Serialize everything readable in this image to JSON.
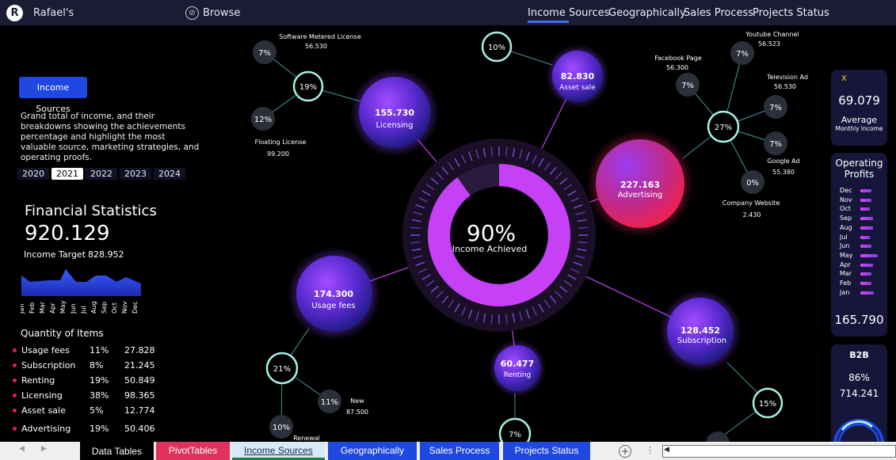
{
  "app": {
    "brand": "Rafael's",
    "logo_letter": "R",
    "browse_label": "Browse"
  },
  "nav": {
    "items": [
      {
        "label": "Income Sources",
        "active": true
      },
      {
        "label": "Geographically"
      },
      {
        "label": "Sales Process"
      },
      {
        "label": "Projects Status"
      }
    ]
  },
  "left": {
    "button_label": "Income Sources",
    "description": "Grand total of income, and their breakdowns showing the achievements percentage and highlight the most valuable source, marketing strategies, and operating proofs.",
    "years": [
      "2020",
      "2021",
      "2022",
      "2023",
      "2024"
    ],
    "active_year": "2021",
    "fin_title": "Financial Statistics",
    "fin_value": "920.129",
    "target_label": "Income Target",
    "target_value": "828.952",
    "sparkline_months": [
      "Jan",
      "Feb",
      "Mar",
      "Apr",
      "May",
      "Jun",
      "Jul",
      "Aug",
      "Sep",
      "Oct",
      "Nov",
      "Dec"
    ],
    "qty_title": "Quantity of Items",
    "items": [
      {
        "name": "Usage fees",
        "pct": "11%",
        "value": "27.828"
      },
      {
        "name": "Subscription",
        "pct": "8%",
        "value": "21.245"
      },
      {
        "name": "Renting",
        "pct": "19%",
        "value": "50.849"
      },
      {
        "name": "Licensing",
        "pct": "38%",
        "value": "98.365"
      },
      {
        "name": "Asset sale",
        "pct": "5%",
        "value": "12.774"
      },
      {
        "name": "Advertising",
        "pct": "19%",
        "value": "50.406"
      }
    ]
  },
  "center": {
    "percent": "90%",
    "label": "Income Achieved",
    "fraction": 0.9
  },
  "bubbles": [
    {
      "key": "licensing",
      "value": "155.730",
      "label": "Licensing"
    },
    {
      "key": "asset-sale",
      "value": "82.830",
      "label": "Asset sale"
    },
    {
      "key": "advertising",
      "value": "227.163",
      "label": "Advertising"
    },
    {
      "key": "usage-fees",
      "value": "174.300",
      "label": "Usage fees"
    },
    {
      "key": "renting",
      "value": "60.477",
      "label": "Renting"
    },
    {
      "key": "subscription",
      "value": "128.452",
      "label": "Subscription"
    }
  ],
  "hubs": [
    "19%",
    "10%",
    "27%",
    "21%",
    "7%",
    "15%"
  ],
  "leaves": [
    {
      "key": "software-metered",
      "pct": "7%",
      "name": "Software Metered License",
      "value": "56.530"
    },
    {
      "key": "floating-license",
      "pct": "12%",
      "name": "Floating License",
      "value": "99.200"
    },
    {
      "key": "facebook-page",
      "pct": "7%",
      "name": "Facebook Page",
      "value": "56.300"
    },
    {
      "key": "youtube-channel",
      "pct": "7%",
      "name": "Youtube Channel",
      "value": "56.523"
    },
    {
      "key": "television-ad",
      "pct": "7%",
      "name": "Television Ad",
      "value": "56.530"
    },
    {
      "key": "google-ad",
      "pct": "7%",
      "name": "Google Ad",
      "value": "55.380"
    },
    {
      "key": "company-website",
      "pct": "0%",
      "name": "Company Website",
      "value": "2.430"
    },
    {
      "key": "new",
      "pct": "11%",
      "name": "New",
      "value": "87.500"
    },
    {
      "key": "renewal",
      "pct": "10%",
      "name": "Renewal",
      "value": ""
    }
  ],
  "right": {
    "card1": {
      "icon": "x-icon",
      "value": "69.079",
      "label": "Average",
      "sub": "Monthly Income"
    },
    "card2": {
      "title": "Operating Profits",
      "months": [
        {
          "m": "Dec",
          "level": 0.55
        },
        {
          "m": "Nov",
          "level": 0.55
        },
        {
          "m": "Oct",
          "level": 0.45
        },
        {
          "m": "Sep",
          "level": 0.6
        },
        {
          "m": "Aug",
          "level": 0.6
        },
        {
          "m": "Jul",
          "level": 0.45
        },
        {
          "m": "Jun",
          "level": 0.55
        },
        {
          "m": "May",
          "level": 0.85
        },
        {
          "m": "Apr",
          "level": 0.6
        },
        {
          "m": "Mar",
          "level": 0.55
        },
        {
          "m": "Feb",
          "level": 0.55
        },
        {
          "m": "Jan",
          "level": 0.65
        }
      ],
      "value": "165.790"
    },
    "card3": {
      "title": "B2B",
      "pct": "86%",
      "value": "714.241"
    }
  },
  "sheets": [
    {
      "label": "Data Tables",
      "color": "#000000"
    },
    {
      "label": "PivotTables",
      "color": "#e0305c"
    },
    {
      "label": "Income Sources",
      "color": "#d8e8f8",
      "active": true
    },
    {
      "label": "Geographically",
      "color": "#1f48e0"
    },
    {
      "label": "Sales Process",
      "color": "#1f48e0"
    },
    {
      "label": "Projects Status",
      "color": "#1f48e0"
    }
  ],
  "colors": {
    "accent": "#1f48e0",
    "hub_ring": "#aaf0e8",
    "bubble_purple": "#7a3ee0",
    "bubble_pink": "#e0205c"
  }
}
